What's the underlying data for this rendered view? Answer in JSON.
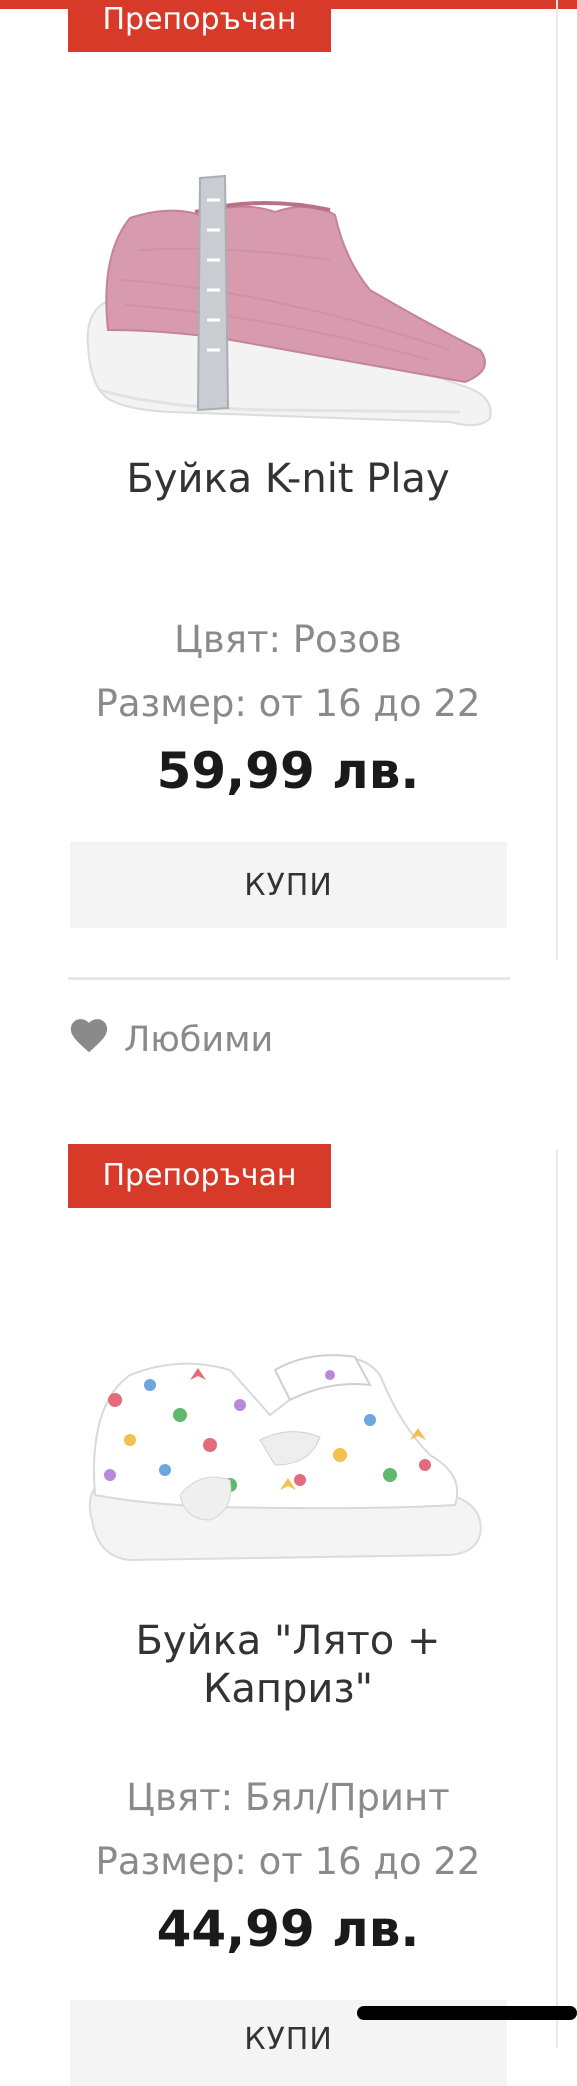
{
  "badge_label": "Препоръчан",
  "products": [
    {
      "name": "Буйка K-nit Play",
      "color": "Цвят: Розов",
      "size": "Размер: от 16 до 22",
      "price": "59,99 лв.",
      "buy_label": "КУПИ",
      "favorite_label": "Любими"
    },
    {
      "name_line1": "Буйка \"Лято +",
      "name_line2": "Каприз\"",
      "color": "Цвят: Бял/Принт",
      "size": "Размер: от 16 до 22",
      "price": "44,99 лв.",
      "buy_label": "КУПИ"
    }
  ],
  "colors": {
    "brand_red": "#d83a2a",
    "button_bg": "#f4f4f4",
    "muted_text": "#8a8a8a"
  }
}
